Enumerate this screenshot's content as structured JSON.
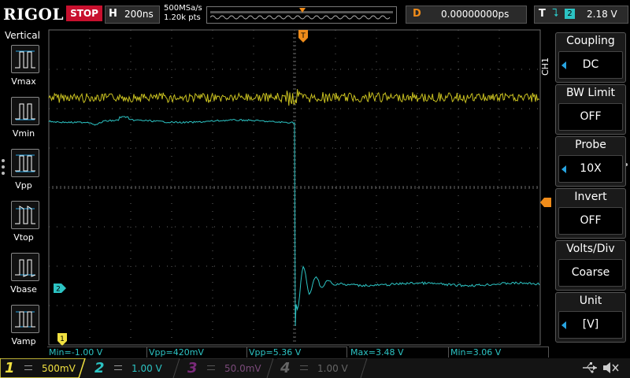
{
  "top": {
    "logo": "RIGOL",
    "run_state": "STOP",
    "timebase_key": "H",
    "timebase": "200ns",
    "sample_rate": "500MSa/s",
    "memory_depth": "1.20k pts",
    "delay_key": "D",
    "delay": "0.00000000ps",
    "trigger_key": "T",
    "trigger_source": "2",
    "trigger_level": "2.18 V"
  },
  "left_panel": {
    "title": "Vertical",
    "items": [
      "Vmax",
      "Vmin",
      "Vpp",
      "Vtop",
      "Vbase",
      "Vamp"
    ]
  },
  "right_panel": {
    "channel_label": "CH1",
    "items": [
      {
        "title": "Coupling",
        "value": "DC"
      },
      {
        "title": "BW Limit",
        "value": "OFF"
      },
      {
        "title": "Probe",
        "value": "10X"
      },
      {
        "title": "Invert",
        "value": "OFF"
      },
      {
        "title": "Volts/Div",
        "value": "Coarse"
      },
      {
        "title": "Unit",
        "value": "[V]"
      }
    ]
  },
  "measurements": [
    "Min=-1.00 V",
    "Vpp=420mV",
    "Vpp=5.36 V",
    "Max=3.48 V",
    "Min=3.06 V"
  ],
  "channels": [
    {
      "num": "1",
      "scale": "500mV",
      "color": "#f0e040"
    },
    {
      "num": "2",
      "scale": "1.00 V",
      "color": "#2cc4c4"
    },
    {
      "num": "3",
      "scale": "50.0mV",
      "color": "#c040c0"
    },
    {
      "num": "4",
      "scale": "1.00 V",
      "color": "#4060e0"
    }
  ],
  "markers": {
    "ch2": "2",
    "ch1_ground": "1",
    "trigger_position": "T"
  },
  "colors": {
    "ch1": "#d8d020",
    "ch2": "#2cc4c4",
    "trigger": "#f08c1a",
    "accent": "#27a4e1"
  }
}
